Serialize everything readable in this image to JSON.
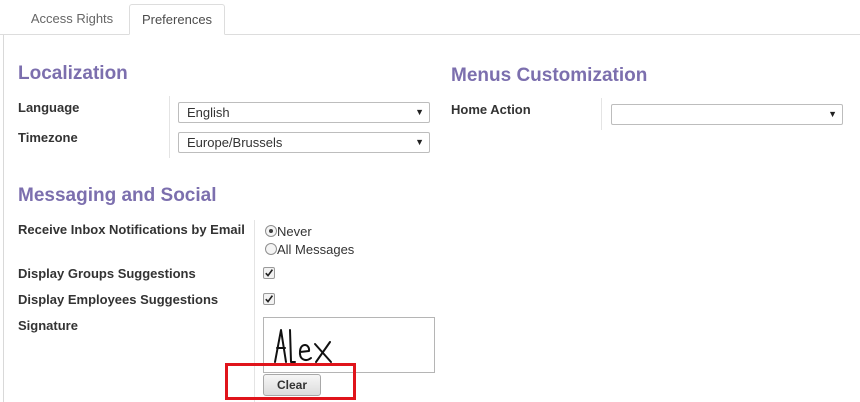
{
  "tabs": [
    {
      "label": "Access Rights",
      "active": false
    },
    {
      "label": "Preferences",
      "active": true
    }
  ],
  "localization": {
    "title": "Localization",
    "language_label": "Language",
    "language_value": "English",
    "timezone_label": "Timezone",
    "timezone_value": "Europe/Brussels"
  },
  "menus": {
    "title": "Menus Customization",
    "home_action_label": "Home Action",
    "home_action_value": ""
  },
  "messaging": {
    "title": "Messaging and Social",
    "inbox_label": "Receive Inbox Notifications by Email",
    "inbox_options": [
      {
        "label": "Never",
        "selected": true
      },
      {
        "label": "All Messages",
        "selected": false
      }
    ],
    "groups_label": "Display Groups Suggestions",
    "groups_checked": true,
    "employees_label": "Display Employees Suggestions",
    "employees_checked": true,
    "signature_label": "Signature",
    "signature_text": "Alex",
    "clear_label": "Clear"
  },
  "colors": {
    "section_title": "#7c6fae",
    "highlight": "#e0141b"
  },
  "icons": {
    "dropdown": "caret-down-icon",
    "check": "checkmark-icon"
  }
}
